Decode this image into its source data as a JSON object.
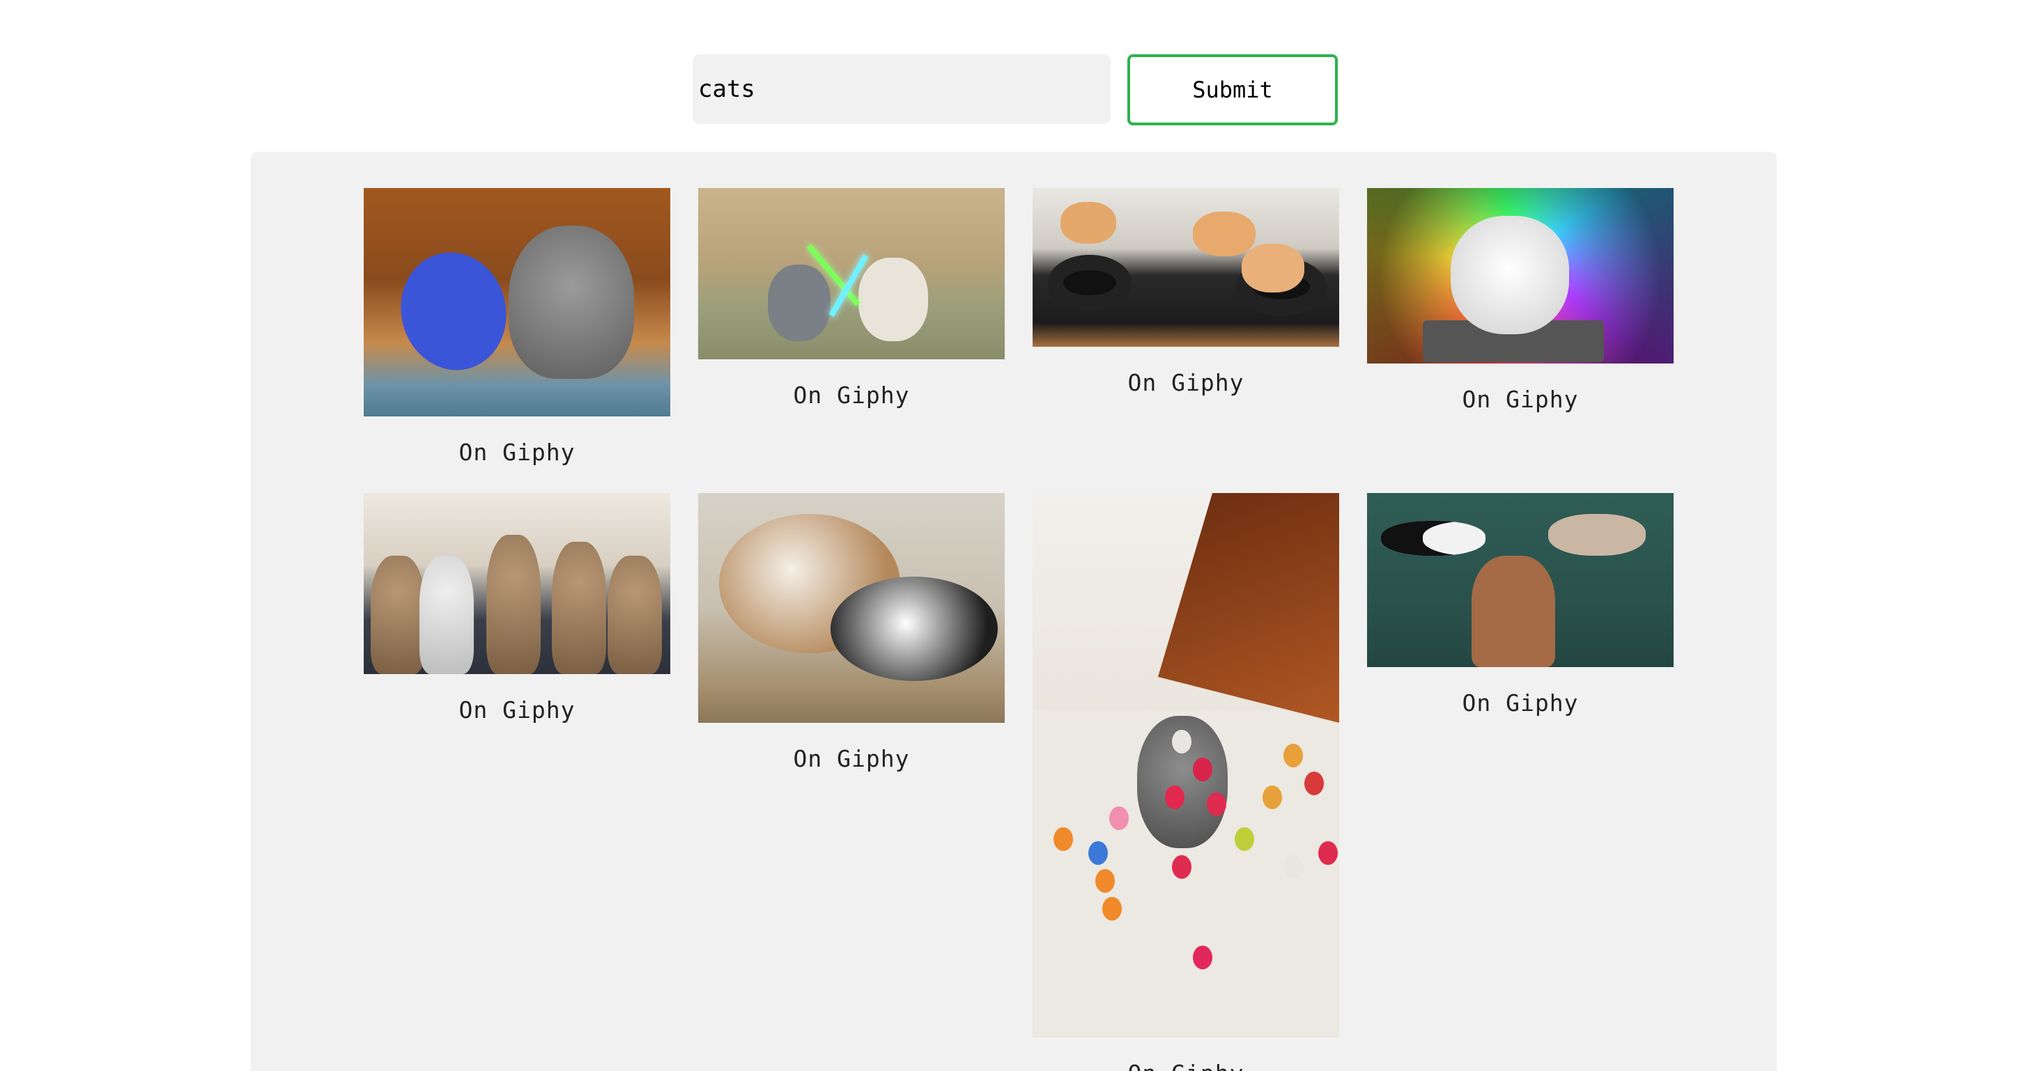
{
  "search": {
    "value": "cats",
    "submit_label": "Submit"
  },
  "colors": {
    "submit_border": "#2fb24c",
    "input_bg": "#f1f1f1",
    "panel_bg": "#f1f1f1"
  },
  "results": [
    {
      "caption": "On Giphy",
      "image": "kitten-ping-pong-gif"
    },
    {
      "caption": "On Giphy",
      "image": "kittens-lightsaber-duel-gif"
    },
    {
      "caption": "On Giphy",
      "image": "kittens-on-dj-turntables-gif"
    },
    {
      "caption": "On Giphy",
      "image": "dj-cat-disco-lights-gif"
    },
    {
      "caption": "On Giphy",
      "image": "kittens-looking-up-gif"
    },
    {
      "caption": "On Giphy",
      "image": "two-cats-cuddling-gif"
    },
    {
      "caption": "On Giphy",
      "image": "kitten-in-ball-pit-gif"
    },
    {
      "caption": "On Giphy",
      "image": "strongman-lifting-cats-gif"
    }
  ]
}
